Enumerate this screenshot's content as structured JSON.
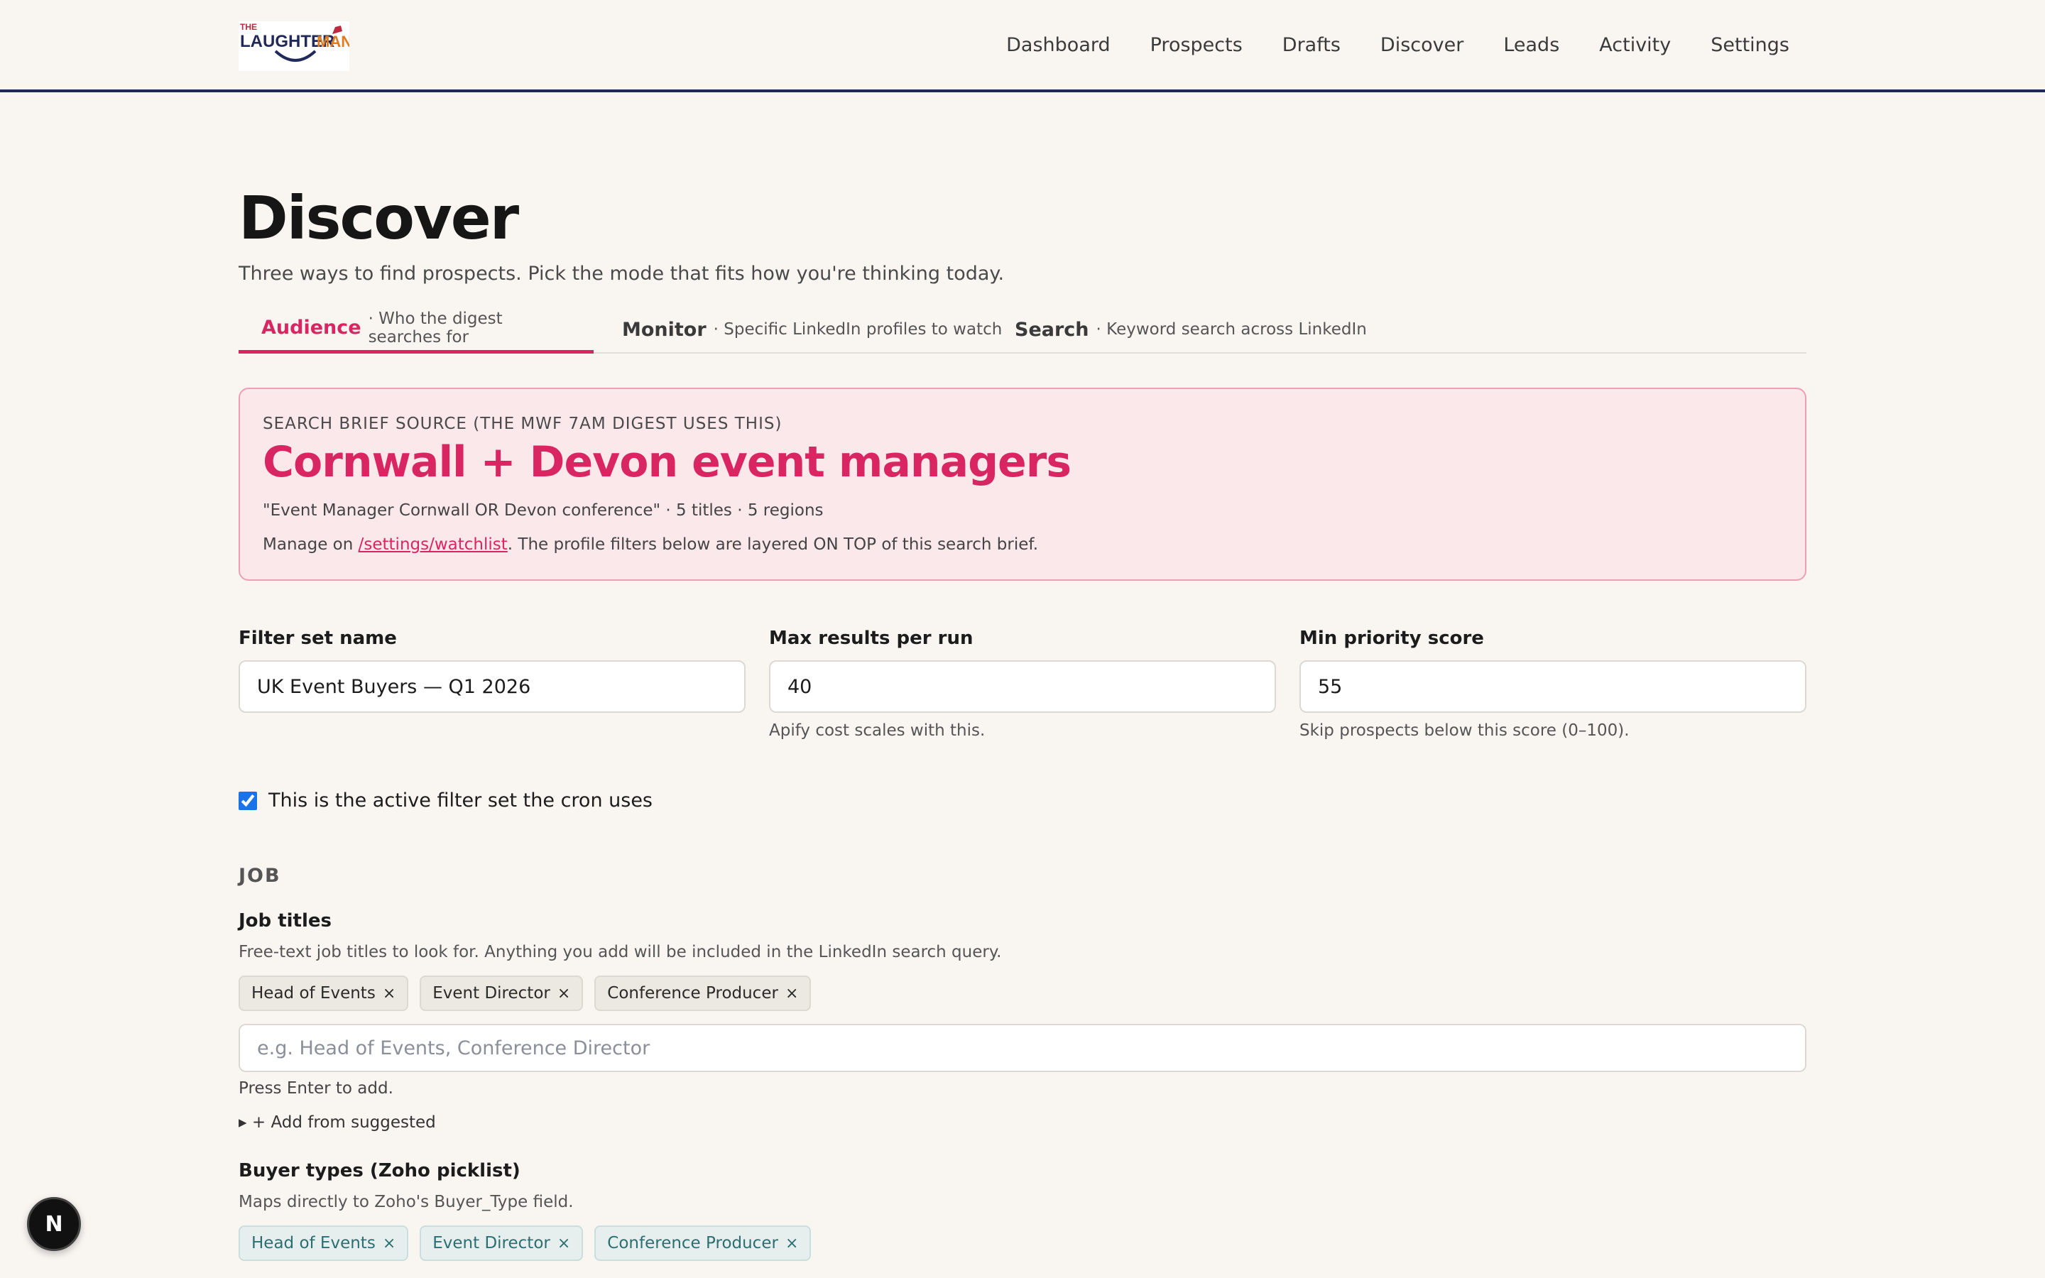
{
  "header": {
    "logo_alt": "THE LAUGHTER MAN",
    "logo_line1": "THE",
    "logo_line2a": "LAUGHTER",
    "logo_line2b": "MAN",
    "nav": [
      "Dashboard",
      "Prospects",
      "Drafts",
      "Discover",
      "Leads",
      "Activity",
      "Settings"
    ]
  },
  "page": {
    "title": "Discover",
    "subtitle": "Three ways to find prospects. Pick the mode that fits how you're thinking today."
  },
  "tabs": [
    {
      "label": "Audience",
      "desc": "· Who the digest searches for",
      "active": true
    },
    {
      "label": "Monitor",
      "desc": "· Specific LinkedIn profiles to watch",
      "active": false
    },
    {
      "label": "Search",
      "desc": "· Keyword search across LinkedIn",
      "active": false
    }
  ],
  "brief": {
    "kicker": "Search brief source (the MWF 7am digest uses this)",
    "title": "Cornwall + Devon event managers",
    "meta": "\"Event Manager Cornwall OR Devon conference\" · 5 titles · 5 regions",
    "manage_prefix": "Manage on ",
    "manage_link": "/settings/watchlist",
    "manage_suffix": ". The profile filters below are layered ON TOP of this search brief."
  },
  "form": {
    "filter_set_name": {
      "label": "Filter set name",
      "value": "UK Event Buyers — Q1 2026"
    },
    "max_results": {
      "label": "Max results per run",
      "value": "40",
      "help": "Apify cost scales with this."
    },
    "min_priority": {
      "label": "Min priority score",
      "value": "55",
      "help": "Skip prospects below this score (0–100)."
    },
    "active_checkbox": {
      "label": "This is the active filter set the cron uses",
      "checked": true
    }
  },
  "job": {
    "section": "JOB",
    "titles_label": "Job titles",
    "titles_help": "Free-text job titles to look for. Anything you add will be included in the LinkedIn search query.",
    "title_chips": [
      "Head of Events",
      "Event Director",
      "Conference Producer"
    ],
    "titles_placeholder": "e.g. Head of Events, Conference Director",
    "press_enter": "Press Enter to add.",
    "add_suggested": "▸  + Add from suggested",
    "buyer_label": "Buyer types (Zoho picklist)",
    "buyer_help": "Maps directly to Zoho's Buyer_Type field.",
    "buyer_chips": [
      "Head of Events",
      "Event Director",
      "Conference Producer"
    ]
  },
  "badge": "N",
  "colors": {
    "accent": "#d92662",
    "brief_bg": "#fae8ea",
    "nav_border": "#1f2a5a",
    "chip_teal": "#2b6f72"
  }
}
